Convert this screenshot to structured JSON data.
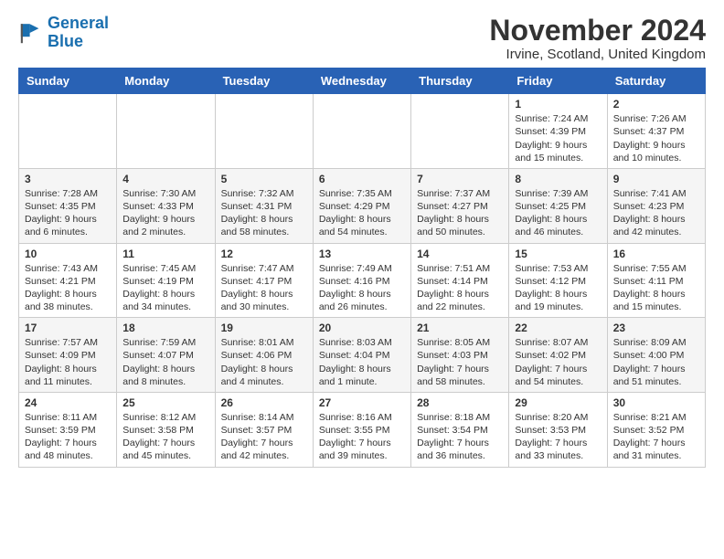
{
  "logo": {
    "line1": "General",
    "line2": "Blue"
  },
  "title": "November 2024",
  "location": "Irvine, Scotland, United Kingdom",
  "days_of_week": [
    "Sunday",
    "Monday",
    "Tuesday",
    "Wednesday",
    "Thursday",
    "Friday",
    "Saturday"
  ],
  "weeks": [
    [
      {
        "day": "",
        "info": ""
      },
      {
        "day": "",
        "info": ""
      },
      {
        "day": "",
        "info": ""
      },
      {
        "day": "",
        "info": ""
      },
      {
        "day": "",
        "info": ""
      },
      {
        "day": "1",
        "info": "Sunrise: 7:24 AM\nSunset: 4:39 PM\nDaylight: 9 hours\nand 15 minutes."
      },
      {
        "day": "2",
        "info": "Sunrise: 7:26 AM\nSunset: 4:37 PM\nDaylight: 9 hours\nand 10 minutes."
      }
    ],
    [
      {
        "day": "3",
        "info": "Sunrise: 7:28 AM\nSunset: 4:35 PM\nDaylight: 9 hours\nand 6 minutes."
      },
      {
        "day": "4",
        "info": "Sunrise: 7:30 AM\nSunset: 4:33 PM\nDaylight: 9 hours\nand 2 minutes."
      },
      {
        "day": "5",
        "info": "Sunrise: 7:32 AM\nSunset: 4:31 PM\nDaylight: 8 hours\nand 58 minutes."
      },
      {
        "day": "6",
        "info": "Sunrise: 7:35 AM\nSunset: 4:29 PM\nDaylight: 8 hours\nand 54 minutes."
      },
      {
        "day": "7",
        "info": "Sunrise: 7:37 AM\nSunset: 4:27 PM\nDaylight: 8 hours\nand 50 minutes."
      },
      {
        "day": "8",
        "info": "Sunrise: 7:39 AM\nSunset: 4:25 PM\nDaylight: 8 hours\nand 46 minutes."
      },
      {
        "day": "9",
        "info": "Sunrise: 7:41 AM\nSunset: 4:23 PM\nDaylight: 8 hours\nand 42 minutes."
      }
    ],
    [
      {
        "day": "10",
        "info": "Sunrise: 7:43 AM\nSunset: 4:21 PM\nDaylight: 8 hours\nand 38 minutes."
      },
      {
        "day": "11",
        "info": "Sunrise: 7:45 AM\nSunset: 4:19 PM\nDaylight: 8 hours\nand 34 minutes."
      },
      {
        "day": "12",
        "info": "Sunrise: 7:47 AM\nSunset: 4:17 PM\nDaylight: 8 hours\nand 30 minutes."
      },
      {
        "day": "13",
        "info": "Sunrise: 7:49 AM\nSunset: 4:16 PM\nDaylight: 8 hours\nand 26 minutes."
      },
      {
        "day": "14",
        "info": "Sunrise: 7:51 AM\nSunset: 4:14 PM\nDaylight: 8 hours\nand 22 minutes."
      },
      {
        "day": "15",
        "info": "Sunrise: 7:53 AM\nSunset: 4:12 PM\nDaylight: 8 hours\nand 19 minutes."
      },
      {
        "day": "16",
        "info": "Sunrise: 7:55 AM\nSunset: 4:11 PM\nDaylight: 8 hours\nand 15 minutes."
      }
    ],
    [
      {
        "day": "17",
        "info": "Sunrise: 7:57 AM\nSunset: 4:09 PM\nDaylight: 8 hours\nand 11 minutes."
      },
      {
        "day": "18",
        "info": "Sunrise: 7:59 AM\nSunset: 4:07 PM\nDaylight: 8 hours\nand 8 minutes."
      },
      {
        "day": "19",
        "info": "Sunrise: 8:01 AM\nSunset: 4:06 PM\nDaylight: 8 hours\nand 4 minutes."
      },
      {
        "day": "20",
        "info": "Sunrise: 8:03 AM\nSunset: 4:04 PM\nDaylight: 8 hours\nand 1 minute."
      },
      {
        "day": "21",
        "info": "Sunrise: 8:05 AM\nSunset: 4:03 PM\nDaylight: 7 hours\nand 58 minutes."
      },
      {
        "day": "22",
        "info": "Sunrise: 8:07 AM\nSunset: 4:02 PM\nDaylight: 7 hours\nand 54 minutes."
      },
      {
        "day": "23",
        "info": "Sunrise: 8:09 AM\nSunset: 4:00 PM\nDaylight: 7 hours\nand 51 minutes."
      }
    ],
    [
      {
        "day": "24",
        "info": "Sunrise: 8:11 AM\nSunset: 3:59 PM\nDaylight: 7 hours\nand 48 minutes."
      },
      {
        "day": "25",
        "info": "Sunrise: 8:12 AM\nSunset: 3:58 PM\nDaylight: 7 hours\nand 45 minutes."
      },
      {
        "day": "26",
        "info": "Sunrise: 8:14 AM\nSunset: 3:57 PM\nDaylight: 7 hours\nand 42 minutes."
      },
      {
        "day": "27",
        "info": "Sunrise: 8:16 AM\nSunset: 3:55 PM\nDaylight: 7 hours\nand 39 minutes."
      },
      {
        "day": "28",
        "info": "Sunrise: 8:18 AM\nSunset: 3:54 PM\nDaylight: 7 hours\nand 36 minutes."
      },
      {
        "day": "29",
        "info": "Sunrise: 8:20 AM\nSunset: 3:53 PM\nDaylight: 7 hours\nand 33 minutes."
      },
      {
        "day": "30",
        "info": "Sunrise: 8:21 AM\nSunset: 3:52 PM\nDaylight: 7 hours\nand 31 minutes."
      }
    ]
  ]
}
